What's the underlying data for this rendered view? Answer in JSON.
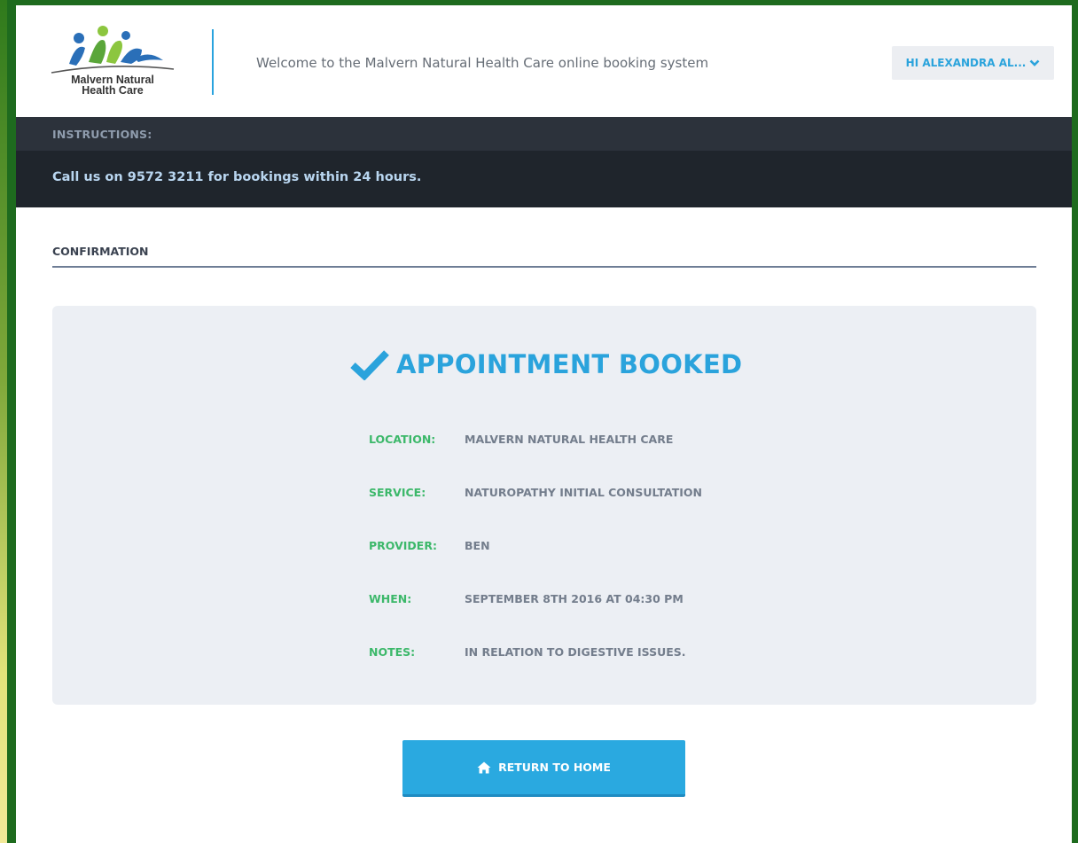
{
  "header": {
    "logo_text": [
      "Malvern Natural",
      "Health Care"
    ],
    "welcome": "Welcome to the Malvern Natural Health Care online booking system",
    "user_menu_label": "HI ALEXANDRA AL..."
  },
  "instructions": {
    "heading": "INSTRUCTIONS:",
    "text": "Call us on 9572 3211 for bookings within 24 hours."
  },
  "section": {
    "title": "CONFIRMATION"
  },
  "confirmation": {
    "status": "APPOINTMENT BOOKED",
    "icon": "check-icon",
    "details": [
      {
        "label": "LOCATION:",
        "value": "MALVERN NATURAL HEALTH CARE"
      },
      {
        "label": "SERVICE:",
        "value": "NATUROPATHY INITIAL CONSULTATION"
      },
      {
        "label": "PROVIDER:",
        "value": "BEN"
      },
      {
        "label": "WHEN:",
        "value": "SEPTEMBER 8TH 2016 AT 04:30 PM"
      },
      {
        "label": "NOTES:",
        "value": "IN RELATION TO DIGESTIVE ISSUES."
      }
    ]
  },
  "actions": {
    "return_home_label": "RETURN TO HOME",
    "return_home_icon": "home-icon"
  },
  "colors": {
    "accent_blue": "#2aa3dc",
    "label_green": "#3cb86a",
    "dark_bar": "#1f252c",
    "frame_green": "#1e6b1e"
  }
}
